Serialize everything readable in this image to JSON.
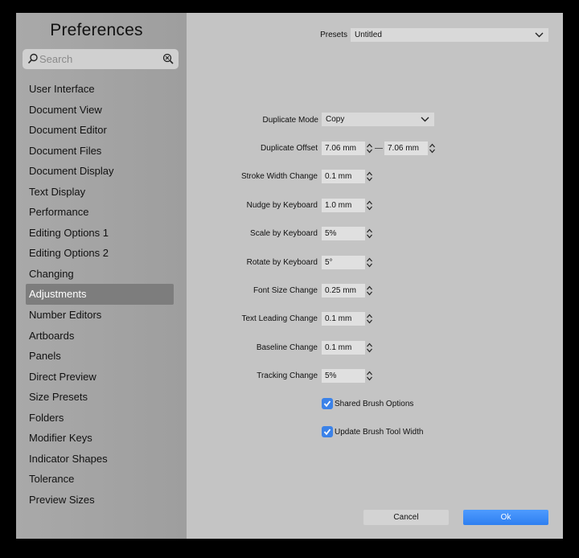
{
  "sidebar": {
    "title": "Preferences",
    "search_placeholder": "Search",
    "items": [
      {
        "label": "User Interface"
      },
      {
        "label": "Document View"
      },
      {
        "label": "Document Editor"
      },
      {
        "label": "Document Files"
      },
      {
        "label": "Document Display"
      },
      {
        "label": "Text Display"
      },
      {
        "label": "Performance"
      },
      {
        "label": "Editing Options 1"
      },
      {
        "label": "Editing Options 2"
      },
      {
        "label": "Changing"
      },
      {
        "label": "Adjustments"
      },
      {
        "label": "Number Editors"
      },
      {
        "label": "Artboards"
      },
      {
        "label": "Panels"
      },
      {
        "label": "Direct Preview"
      },
      {
        "label": "Size Presets"
      },
      {
        "label": "Folders"
      },
      {
        "label": "Modifier Keys"
      },
      {
        "label": "Indicator Shapes"
      },
      {
        "label": "Tolerance"
      },
      {
        "label": "Preview Sizes"
      }
    ],
    "active_index": 10
  },
  "presets": {
    "label": "Presets",
    "value": "Untitled"
  },
  "settings": {
    "duplicate_mode": {
      "label": "Duplicate Mode",
      "value": "Copy"
    },
    "duplicate_offset": {
      "label": "Duplicate Offset",
      "value_x": "7.06 mm",
      "value_y": "7.06 mm"
    },
    "stroke_width_change": {
      "label": "Stroke Width Change",
      "value": "0.1 mm"
    },
    "nudge_by_keyboard": {
      "label": "Nudge by Keyboard",
      "value": "1.0 mm"
    },
    "scale_by_keyboard": {
      "label": "Scale by Keyboard",
      "value": "5%"
    },
    "rotate_by_keyboard": {
      "label": "Rotate by Keyboard",
      "value": "5°"
    },
    "font_size_change": {
      "label": "Font Size Change",
      "value": "0.25 mm"
    },
    "text_leading_change": {
      "label": "Text Leading Change",
      "value": "0.1 mm"
    },
    "baseline_change": {
      "label": "Baseline Change",
      "value": "0.1 mm"
    },
    "tracking_change": {
      "label": "Tracking Change",
      "value": "5%"
    },
    "shared_brush_options": {
      "label": "Shared Brush Options",
      "checked": true
    },
    "update_brush_tool_width": {
      "label": "Update Brush Tool Width",
      "checked": true
    }
  },
  "buttons": {
    "cancel": "Cancel",
    "ok": "Ok"
  },
  "colors": {
    "accent": "#3b82e8",
    "selection": "#7d7d7d"
  }
}
